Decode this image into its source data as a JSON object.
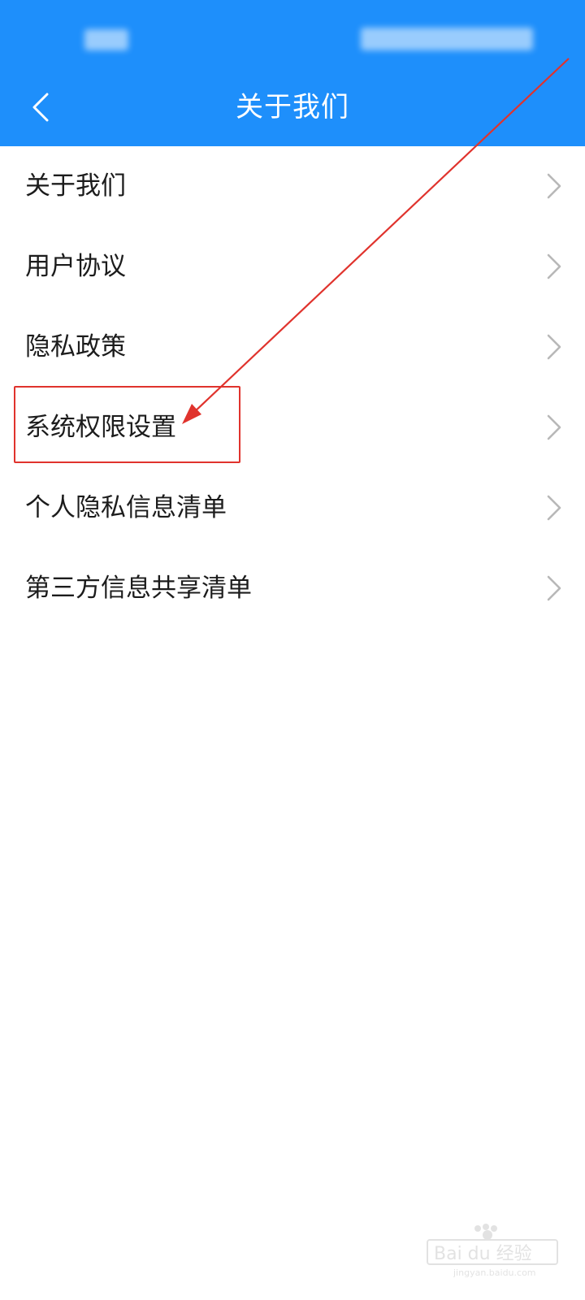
{
  "header": {
    "title": "关于我们",
    "background_color": "#1e8ffb",
    "back_icon": "chevron-left-icon"
  },
  "menu": {
    "items": [
      {
        "label": "关于我们"
      },
      {
        "label": "用户协议"
      },
      {
        "label": "隐私政策"
      },
      {
        "label": "系统权限设置"
      },
      {
        "label": "个人隐私信息清单"
      },
      {
        "label": "第三方信息共享清单"
      }
    ],
    "chevron_icon": "chevron-right-icon"
  },
  "annotation": {
    "color": "#e0332d",
    "highlighted_item": "系统权限设置"
  },
  "watermark": {
    "brand": "Bai 经验",
    "site": "jingyan.baidu.com"
  }
}
